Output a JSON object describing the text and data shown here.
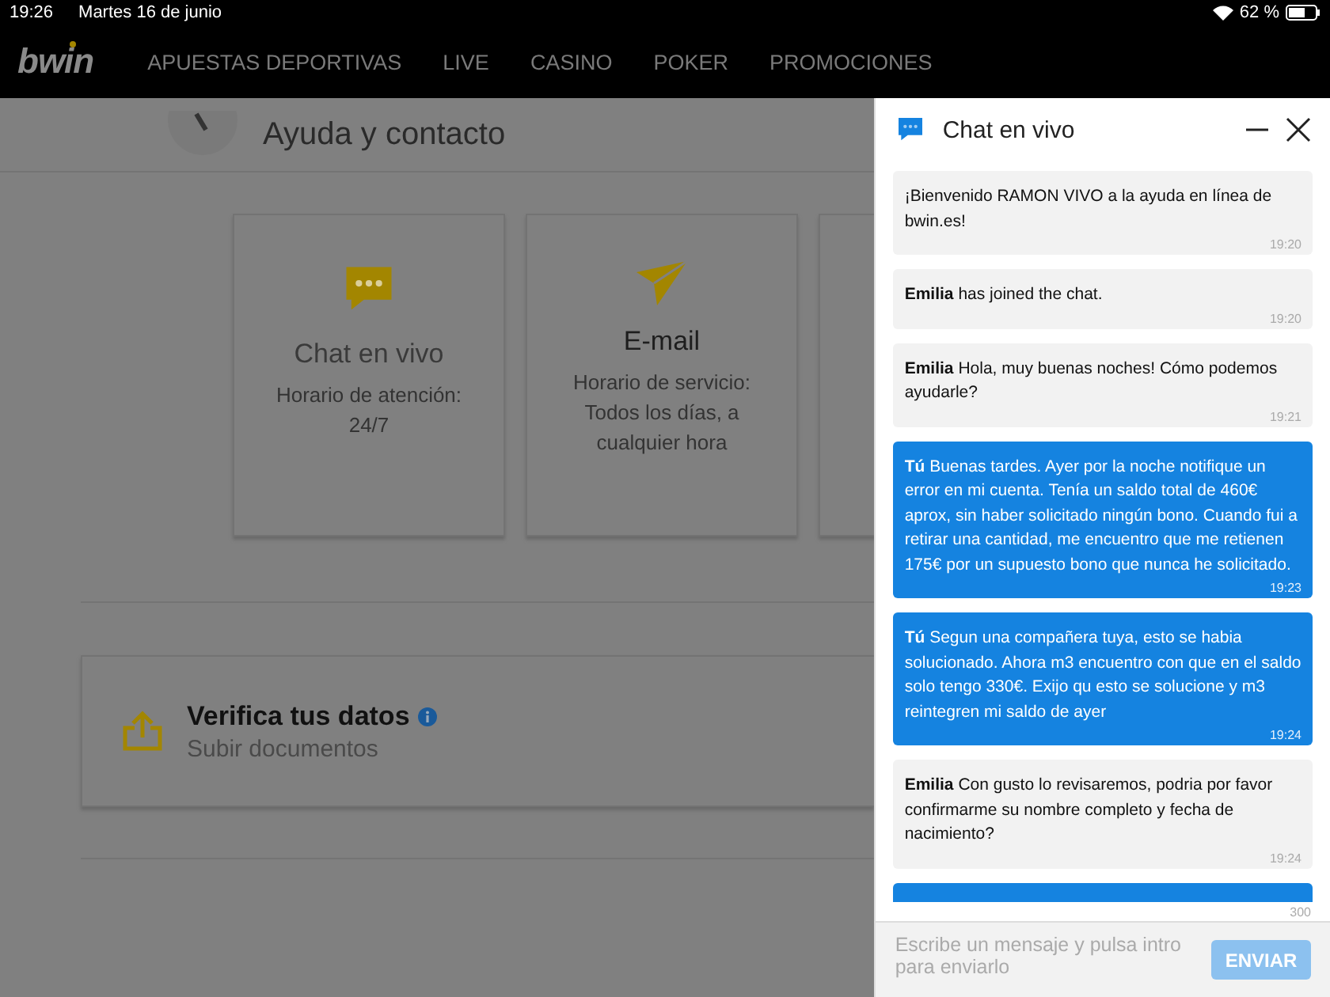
{
  "status_bar": {
    "time": "19:26",
    "date": "Martes 16 de junio",
    "battery": "62 %"
  },
  "nav": {
    "logo": "bwin",
    "items": [
      "APUESTAS DEPORTIVAS",
      "LIVE",
      "CASINO",
      "POKER",
      "PROMOCIONES"
    ]
  },
  "page": {
    "title": "Ayuda y contacto",
    "cards": [
      {
        "kind": "chat",
        "title": "Chat en vivo",
        "lines": [
          "Horario de atención:",
          "24/7"
        ]
      },
      {
        "kind": "email",
        "title": "E-mail",
        "lines": [
          "Horario de servicio:",
          "Todos los días, a",
          "cualquier hora"
        ]
      }
    ],
    "verify": {
      "title": "Verifica tus datos",
      "subtitle": "Subir documentos"
    }
  },
  "chat": {
    "title": "Chat en vivo",
    "messages": [
      {
        "kind": "agent",
        "text": "¡Bienvenido RAMON VIVO a la ayuda en línea de bwin.es!",
        "time": "19:20"
      },
      {
        "kind": "agent",
        "sender": "Emilia",
        "text": "has joined the chat.",
        "time": "19:20"
      },
      {
        "kind": "agent",
        "sender": "Emilia",
        "text": "Hola, muy buenas noches! Cómo podemos ayudarle?",
        "time": "19:21"
      },
      {
        "kind": "user",
        "sender": "Tú",
        "text": "Buenas tardes. Ayer por la noche notifique un error en mi cuenta. Tenía un saldo total de 460€ aprox, sin haber solicitado ningún bono. Cuando fui a retirar una cantidad, me encuentro que me retienen 175€ por un supuesto bono que nunca he solicitado.",
        "time": "19:23"
      },
      {
        "kind": "user",
        "sender": "Tú",
        "text": "Segun una compañera tuya, esto se habia solucionado. Ahora m3 encuentro con que en el saldo solo tengo 330€. Exijo qu esto se solucione y m3 reintegren mi saldo de ayer",
        "time": "19:24"
      },
      {
        "kind": "agent",
        "sender": "Emilia",
        "text": "Con gusto lo revisaremos, podria por favor confirmarme su nombre completo y fecha de nacimiento?",
        "time": "19:24"
      }
    ],
    "char_count": "300",
    "input": {
      "placeholder": "Escribe un mensaje y pulsa intro para enviarlo"
    },
    "send_button": {
      "label": "ENVIAR",
      "disabled": true
    }
  }
}
